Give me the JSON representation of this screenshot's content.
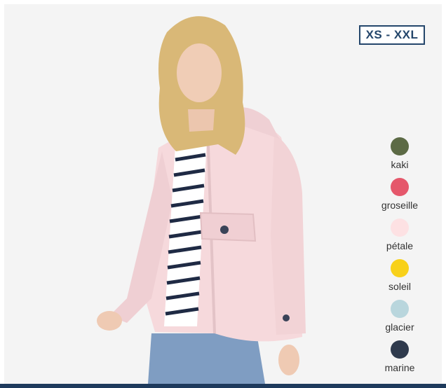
{
  "size_range": "XS - XXL",
  "colors": [
    {
      "label": "kaki",
      "hex": "#5c6a45"
    },
    {
      "label": "groseille",
      "hex": "#e5576b"
    },
    {
      "label": "pétale",
      "hex": "#fde1e3"
    },
    {
      "label": "soleil",
      "hex": "#f8d11a"
    },
    {
      "label": "glacier",
      "hex": "#b9d6dd"
    },
    {
      "label": "marine",
      "hex": "#2f3a4d"
    }
  ],
  "theme": {
    "accent": "#24466b",
    "jacket": "#f6d9dc"
  }
}
